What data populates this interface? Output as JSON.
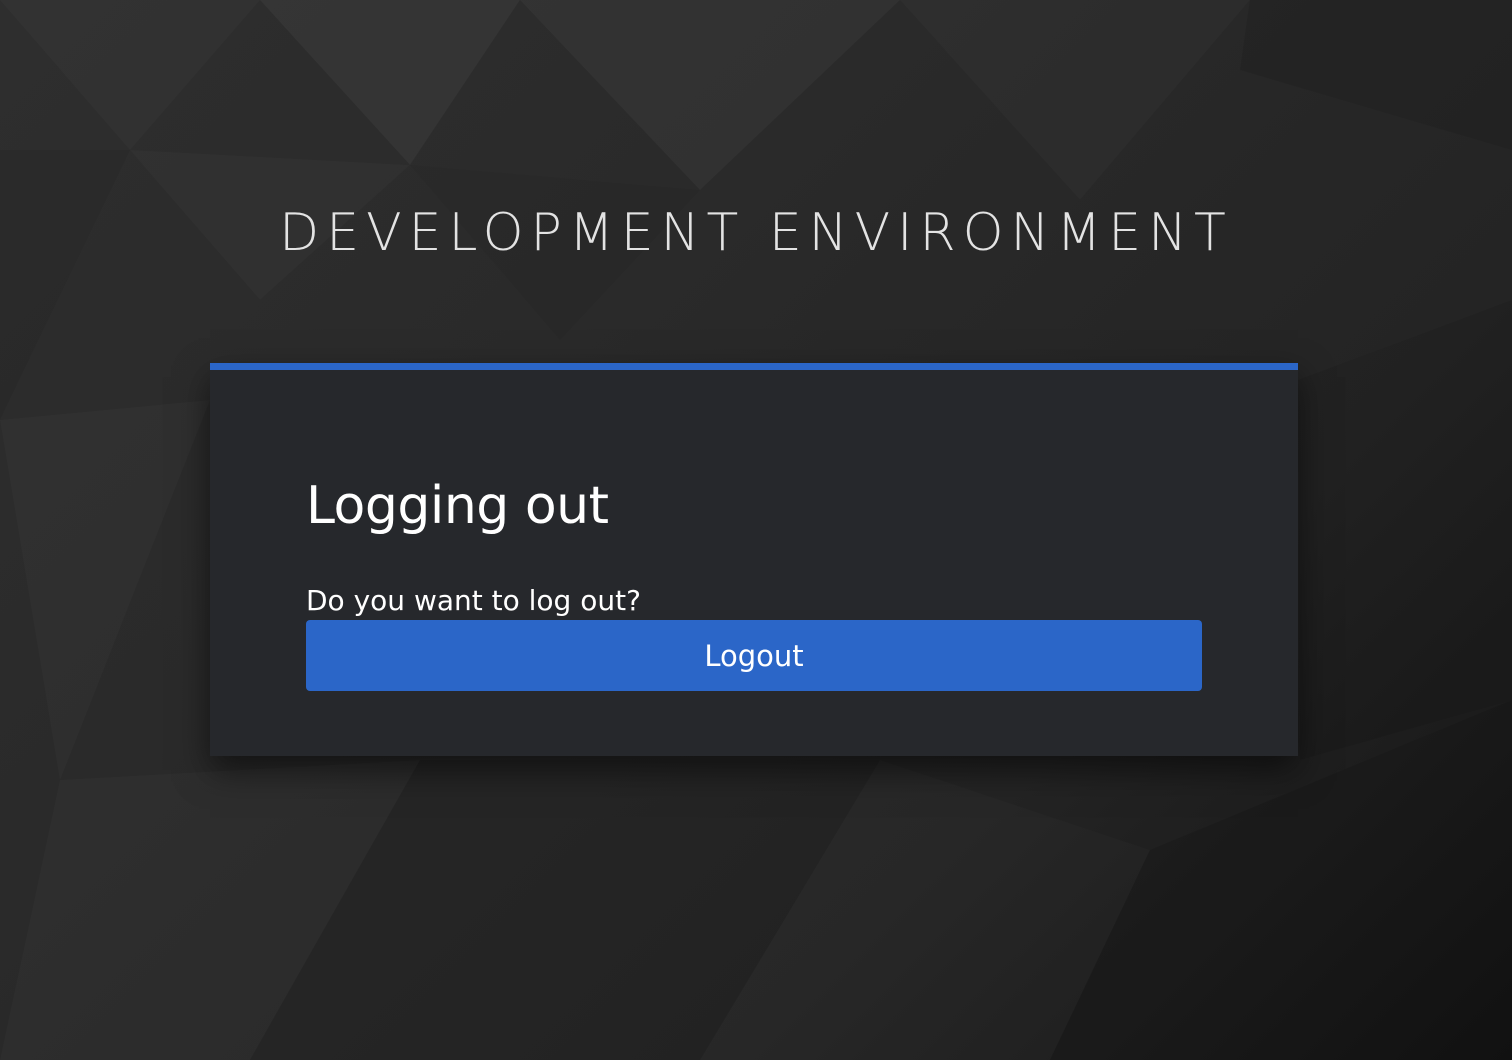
{
  "header": {
    "title": "DEVELOPMENT ENVIRONMENT"
  },
  "card": {
    "title": "Logging out",
    "message": "Do you want to log out?",
    "logout_label": "Logout"
  },
  "colors": {
    "accent": "#2b66c8",
    "card_background": "#26282c",
    "page_background": "#2a2a2a",
    "header_text": "#e3e3e3"
  }
}
